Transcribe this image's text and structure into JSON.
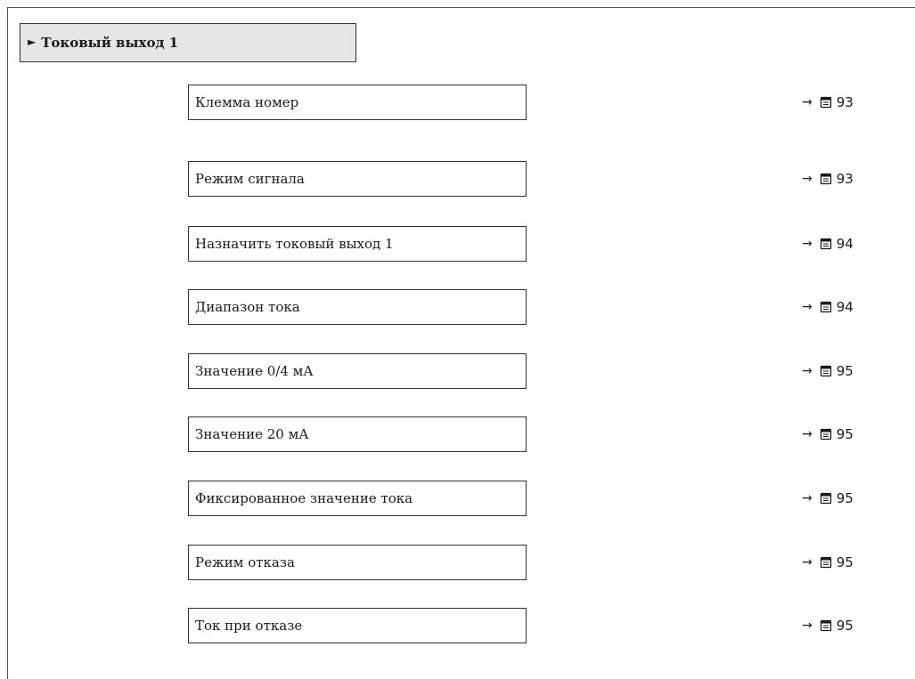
{
  "header": {
    "marker": "►",
    "title": "Токовый выход 1"
  },
  "items": [
    {
      "label": "Клемма номер",
      "page": "93"
    },
    {
      "label": "Режим сигнала",
      "page": "93"
    },
    {
      "label": "Назначить токовый выход 1",
      "page": "94"
    },
    {
      "label": "Диапазон тока",
      "page": "94"
    },
    {
      "label": "Значение 0/4 мА",
      "page": "95"
    },
    {
      "label": "Значение 20 мА",
      "page": "95"
    },
    {
      "label": "Фиксированное значение тока",
      "page": "95"
    },
    {
      "label": "Режим отказа",
      "page": "95"
    },
    {
      "label": "Ток при отказе",
      "page": "95"
    }
  ],
  "ref_arrow": "→",
  "ref_icon": "book-page-icon"
}
